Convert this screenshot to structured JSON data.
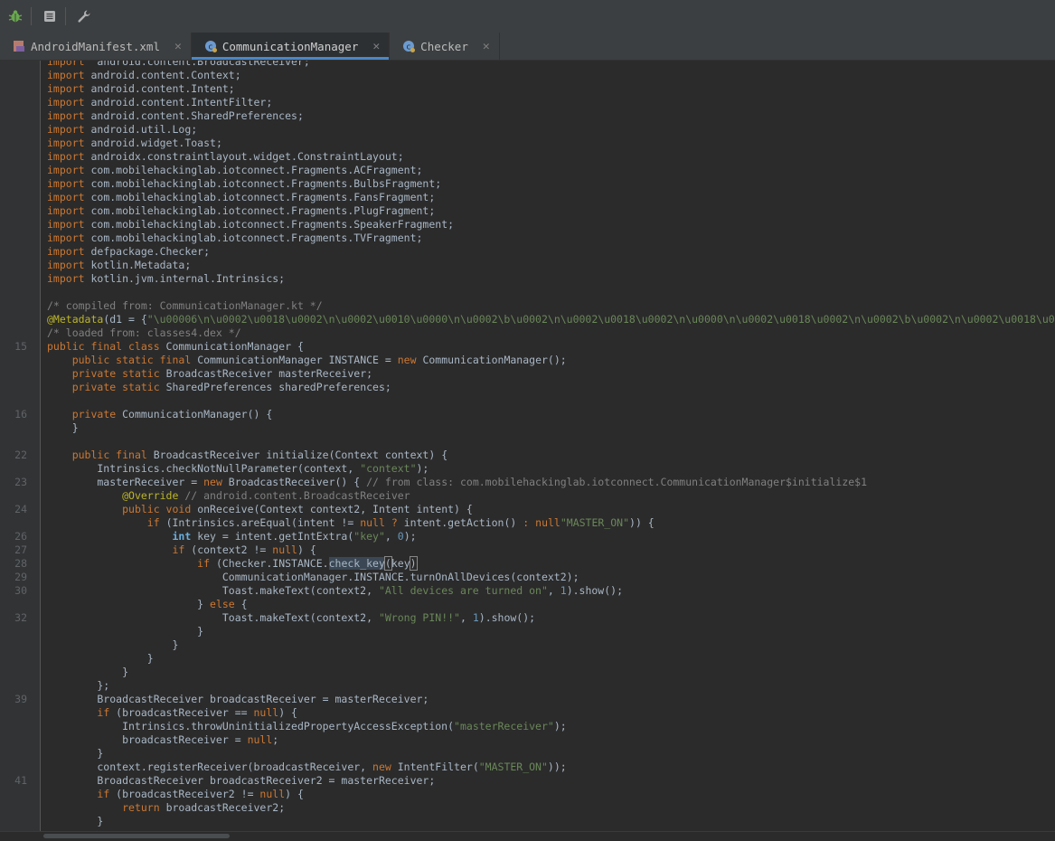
{
  "tabs": [
    {
      "label": "AndroidManifest.xml",
      "icon": "xml-file-icon"
    },
    {
      "label": "CommunicationManager",
      "icon": "java-class-icon"
    },
    {
      "label": "Checker",
      "icon": "java-class-icon"
    }
  ],
  "code_lines": [
    {
      "ln": "",
      "tokens": [
        [
          "kw",
          "import"
        ],
        [
          "",
          "  android.content.BroadcastReceiver;"
        ]
      ]
    },
    {
      "ln": "",
      "tokens": [
        [
          "kw",
          "import"
        ],
        [
          "",
          " android.content.Context;"
        ]
      ]
    },
    {
      "ln": "",
      "tokens": [
        [
          "kw",
          "import"
        ],
        [
          "",
          " android.content.Intent;"
        ]
      ]
    },
    {
      "ln": "",
      "tokens": [
        [
          "kw",
          "import"
        ],
        [
          "",
          " android.content.IntentFilter;"
        ]
      ]
    },
    {
      "ln": "",
      "tokens": [
        [
          "kw",
          "import"
        ],
        [
          "",
          " android.content.SharedPreferences;"
        ]
      ]
    },
    {
      "ln": "",
      "tokens": [
        [
          "kw",
          "import"
        ],
        [
          "",
          " android.util.Log;"
        ]
      ]
    },
    {
      "ln": "",
      "tokens": [
        [
          "kw",
          "import"
        ],
        [
          "",
          " android.widget.Toast;"
        ]
      ]
    },
    {
      "ln": "",
      "tokens": [
        [
          "kw",
          "import"
        ],
        [
          "",
          " androidx.constraintlayout.widget.ConstraintLayout;"
        ]
      ]
    },
    {
      "ln": "",
      "tokens": [
        [
          "kw",
          "import"
        ],
        [
          "",
          " com.mobilehackinglab.iotconnect.Fragments.ACFragment;"
        ]
      ]
    },
    {
      "ln": "",
      "tokens": [
        [
          "kw",
          "import"
        ],
        [
          "",
          " com.mobilehackinglab.iotconnect.Fragments.BulbsFragment;"
        ]
      ]
    },
    {
      "ln": "",
      "tokens": [
        [
          "kw",
          "import"
        ],
        [
          "",
          " com.mobilehackinglab.iotconnect.Fragments.FansFragment;"
        ]
      ]
    },
    {
      "ln": "",
      "tokens": [
        [
          "kw",
          "import"
        ],
        [
          "",
          " com.mobilehackinglab.iotconnect.Fragments.PlugFragment;"
        ]
      ]
    },
    {
      "ln": "",
      "tokens": [
        [
          "kw",
          "import"
        ],
        [
          "",
          " com.mobilehackinglab.iotconnect.Fragments.SpeakerFragment;"
        ]
      ]
    },
    {
      "ln": "",
      "tokens": [
        [
          "kw",
          "import"
        ],
        [
          "",
          " com.mobilehackinglab.iotconnect.Fragments.TVFragment;"
        ]
      ]
    },
    {
      "ln": "",
      "tokens": [
        [
          "kw",
          "import"
        ],
        [
          "",
          " defpackage.Checker;"
        ]
      ]
    },
    {
      "ln": "",
      "tokens": [
        [
          "kw",
          "import"
        ],
        [
          "",
          " kotlin.Metadata;"
        ]
      ]
    },
    {
      "ln": "",
      "tokens": [
        [
          "kw",
          "import"
        ],
        [
          "",
          " kotlin.jvm.internal.Intrinsics;"
        ]
      ]
    },
    {
      "ln": "",
      "tokens": []
    },
    {
      "ln": "",
      "tokens": [
        [
          "cm",
          "/* compiled from: CommunicationManager.kt */"
        ]
      ]
    },
    {
      "ln": "",
      "tokens": [
        [
          "ann",
          "@Metadata"
        ],
        [
          "",
          "(d1 = {"
        ],
        [
          "str",
          "\"\\u00006\\n\\u0002\\u0018\\u0002\\n\\u0002\\u0010\\u0000\\n\\u0002\\b\\u0002\\n\\u0002\\u0018\\u0002\\n\\u0000\\n\\u0002\\u0018\\u0002\\n\\u0002\\b\\u0002\\n\\u0002\\u0018\\u0002\\n\\u0002\\b"
        ]
      ]
    },
    {
      "ln": "",
      "tokens": [
        [
          "cm",
          "/* loaded from: classes4.dex */"
        ]
      ]
    },
    {
      "ln": "15",
      "tokens": [
        [
          "kw",
          "public final class"
        ],
        [
          "",
          " CommunicationManager {"
        ]
      ]
    },
    {
      "ln": "",
      "tokens": [
        [
          "",
          "    "
        ],
        [
          "kw",
          "public static final"
        ],
        [
          "",
          " CommunicationManager INSTANCE = "
        ],
        [
          "kw",
          "new"
        ],
        [
          "",
          " CommunicationManager();"
        ]
      ]
    },
    {
      "ln": "",
      "tokens": [
        [
          "",
          "    "
        ],
        [
          "kw",
          "private static"
        ],
        [
          "",
          " BroadcastReceiver masterReceiver;"
        ]
      ]
    },
    {
      "ln": "",
      "tokens": [
        [
          "",
          "    "
        ],
        [
          "kw",
          "private static"
        ],
        [
          "",
          " SharedPreferences sharedPreferences;"
        ]
      ]
    },
    {
      "ln": "",
      "tokens": []
    },
    {
      "ln": "16",
      "tokens": [
        [
          "",
          "    "
        ],
        [
          "kw",
          "private"
        ],
        [
          "",
          " CommunicationManager() {"
        ]
      ]
    },
    {
      "ln": "",
      "tokens": [
        [
          "",
          "    }"
        ]
      ]
    },
    {
      "ln": "",
      "tokens": []
    },
    {
      "ln": "22",
      "tokens": [
        [
          "",
          "    "
        ],
        [
          "kw",
          "public final"
        ],
        [
          "",
          " BroadcastReceiver initialize(Context context) {"
        ]
      ]
    },
    {
      "ln": "",
      "tokens": [
        [
          "",
          "        Intrinsics.checkNotNullParameter(context, "
        ],
        [
          "str",
          "\"context\""
        ],
        [
          "",
          ");"
        ]
      ]
    },
    {
      "ln": "23",
      "tokens": [
        [
          "",
          "        masterReceiver = "
        ],
        [
          "kw",
          "new"
        ],
        [
          "",
          " BroadcastReceiver() { "
        ],
        [
          "cm",
          "// from class: com.mobilehackinglab.iotconnect.CommunicationManager$initialize$1"
        ]
      ]
    },
    {
      "ln": "",
      "tokens": [
        [
          "",
          "            "
        ],
        [
          "ann",
          "@Override"
        ],
        [
          "",
          " "
        ],
        [
          "cm",
          "// android.content.BroadcastReceiver"
        ]
      ]
    },
    {
      "ln": "24",
      "tokens": [
        [
          "",
          "            "
        ],
        [
          "kw",
          "public void"
        ],
        [
          "",
          " onReceive(Context context2, Intent intent) {"
        ]
      ]
    },
    {
      "ln": "",
      "tokens": [
        [
          "",
          "                "
        ],
        [
          "kw",
          "if"
        ],
        [
          "",
          " (Intrinsics.areEqual(intent != "
        ],
        [
          "kw",
          "null"
        ],
        [
          "",
          " "
        ],
        [
          "kw",
          "?"
        ],
        [
          "",
          " intent.getAction() "
        ],
        [
          "kw",
          ":"
        ],
        [
          "",
          " "
        ],
        [
          "kw",
          "null"
        ],
        [
          ", "
        ],
        [
          "str",
          "\"MASTER_ON\""
        ],
        [
          "",
          ")) {"
        ]
      ]
    },
    {
      "ln": "26",
      "tokens": [
        [
          "",
          "                    "
        ],
        [
          "kwb",
          "int"
        ],
        [
          "",
          " key = intent.getIntExtra("
        ],
        [
          "str",
          "\"key\""
        ],
        [
          "",
          ", "
        ],
        [
          "num",
          "0"
        ],
        [
          "",
          ");"
        ]
      ]
    },
    {
      "ln": "27",
      "tokens": [
        [
          "",
          "                    "
        ],
        [
          "kw",
          "if"
        ],
        [
          "",
          " (context2 != "
        ],
        [
          "kw",
          "null"
        ],
        [
          "",
          ") {"
        ]
      ]
    },
    {
      "ln": "28",
      "tokens": [
        [
          "",
          "                        "
        ],
        [
          "kw",
          "if"
        ],
        [
          "",
          " (Checker.INSTANCE."
        ],
        [
          "hl",
          "check_key"
        ],
        [
          "brk",
          "("
        ],
        [
          "",
          "key"
        ],
        [
          "brk",
          ")"
        ],
        [
          ") {"
        ]
      ]
    },
    {
      "ln": "29",
      "tokens": [
        [
          "",
          "                            CommunicationManager.INSTANCE.turnOnAllDevices(context2);"
        ]
      ]
    },
    {
      "ln": "30",
      "tokens": [
        [
          "",
          "                            Toast.makeText(context2, "
        ],
        [
          "str",
          "\"All devices are turned on\""
        ],
        [
          "",
          ", "
        ],
        [
          "num",
          "1"
        ],
        [
          "",
          ").show();"
        ]
      ]
    },
    {
      "ln": "",
      "tokens": [
        [
          "",
          "                        } "
        ],
        [
          "kw",
          "else"
        ],
        [
          "",
          " {"
        ]
      ]
    },
    {
      "ln": "32",
      "tokens": [
        [
          "",
          "                            Toast.makeText(context2, "
        ],
        [
          "str",
          "\"Wrong PIN!!\""
        ],
        [
          "",
          ", "
        ],
        [
          "num",
          "1"
        ],
        [
          "",
          ").show();"
        ]
      ]
    },
    {
      "ln": "",
      "tokens": [
        [
          "",
          "                        }"
        ]
      ]
    },
    {
      "ln": "",
      "tokens": [
        [
          "",
          "                    }"
        ]
      ]
    },
    {
      "ln": "",
      "tokens": [
        [
          "",
          "                }"
        ]
      ]
    },
    {
      "ln": "",
      "tokens": [
        [
          "",
          "            }"
        ]
      ]
    },
    {
      "ln": "",
      "tokens": [
        [
          "",
          "        };"
        ]
      ]
    },
    {
      "ln": "39",
      "tokens": [
        [
          "",
          "        BroadcastReceiver broadcastReceiver = masterReceiver;"
        ]
      ]
    },
    {
      "ln": "",
      "tokens": [
        [
          "",
          "        "
        ],
        [
          "kw",
          "if"
        ],
        [
          "",
          " (broadcastReceiver == "
        ],
        [
          "kw",
          "null"
        ],
        [
          "",
          ") {"
        ]
      ]
    },
    {
      "ln": "",
      "tokens": [
        [
          "",
          "            Intrinsics.throwUninitializedPropertyAccessException("
        ],
        [
          "str",
          "\"masterReceiver\""
        ],
        [
          "",
          ");"
        ]
      ]
    },
    {
      "ln": "",
      "tokens": [
        [
          "",
          "            broadcastReceiver = "
        ],
        [
          "kw",
          "null"
        ],
        [
          "",
          ";"
        ]
      ]
    },
    {
      "ln": "",
      "tokens": [
        [
          "",
          "        }"
        ]
      ]
    },
    {
      "ln": "",
      "tokens": [
        [
          "",
          "        context.registerReceiver(broadcastReceiver, "
        ],
        [
          "kw",
          "new"
        ],
        [
          "",
          " IntentFilter("
        ],
        [
          "str",
          "\"MASTER_ON\""
        ],
        [
          "",
          "));"
        ]
      ]
    },
    {
      "ln": "41",
      "tokens": [
        [
          "",
          "        BroadcastReceiver broadcastReceiver2 = masterReceiver;"
        ]
      ]
    },
    {
      "ln": "",
      "tokens": [
        [
          "",
          "        "
        ],
        [
          "kw",
          "if"
        ],
        [
          "",
          " (broadcastReceiver2 != "
        ],
        [
          "kw",
          "null"
        ],
        [
          "",
          ") {"
        ]
      ]
    },
    {
      "ln": "",
      "tokens": [
        [
          "",
          "            "
        ],
        [
          "kw",
          "return"
        ],
        [
          "",
          " broadcastReceiver2;"
        ]
      ]
    },
    {
      "ln": "",
      "tokens": [
        [
          "",
          "        }"
        ]
      ]
    }
  ]
}
